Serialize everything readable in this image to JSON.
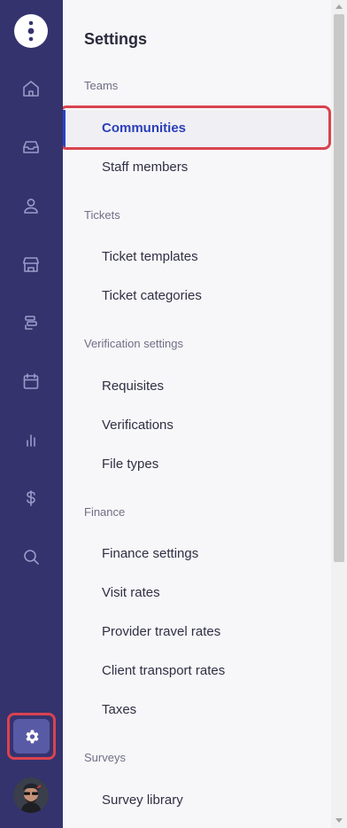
{
  "rail": {
    "icons": [
      "logo-icon",
      "home-icon",
      "inbox-icon",
      "user-icon",
      "store-icon",
      "timeline-icon",
      "calendar-icon",
      "bar-chart-icon",
      "dollar-icon",
      "search-icon",
      "gear-icon",
      "avatar"
    ]
  },
  "panel": {
    "title": "Settings",
    "sections": [
      {
        "label": "Teams",
        "items": [
          "Communities",
          "Staff members"
        ]
      },
      {
        "label": "Tickets",
        "items": [
          "Ticket templates",
          "Ticket categories"
        ]
      },
      {
        "label": "Verification settings",
        "items": [
          "Requisites",
          "Verifications",
          "File types"
        ]
      },
      {
        "label": "Finance",
        "items": [
          "Finance settings",
          "Visit rates",
          "Provider travel rates",
          "Client transport rates",
          "Taxes"
        ]
      },
      {
        "label": "Surveys",
        "items": [
          "Survey library"
        ]
      }
    ],
    "active_item": "Communities"
  },
  "colors": {
    "rail_bg": "#35336e",
    "rail_icon": "#9b9ac9",
    "active_text": "#2b3fb7",
    "active_bar": "#2643c4",
    "highlight": "#d9434f"
  }
}
